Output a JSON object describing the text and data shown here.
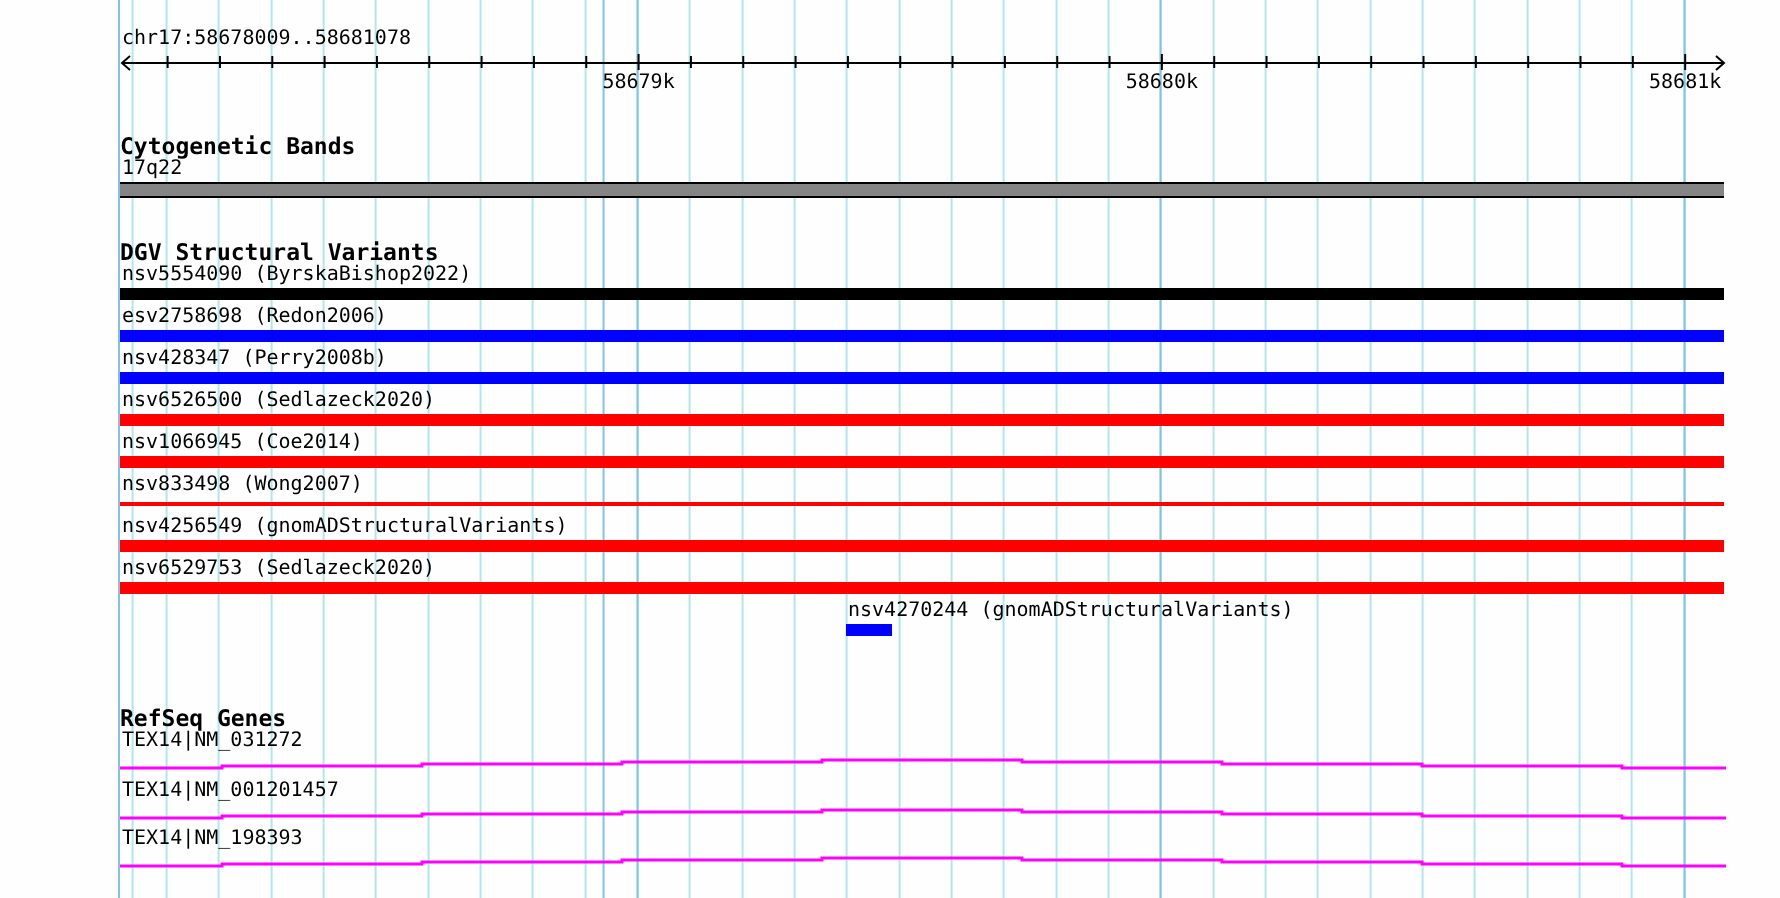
{
  "ruler": {
    "region": "chr17:58678009..58681078",
    "ticks": [
      "58679k",
      "58680k",
      "58681k"
    ]
  },
  "tracks": [
    {
      "kind": "bands",
      "title": "Cytogenetic Bands",
      "features": [
        {
          "label": "17q22"
        }
      ]
    },
    {
      "kind": "variants",
      "title": "DGV Structural Variants",
      "features": [
        {
          "label": "nsv5554090 (ByrskaBishop2022)",
          "color": "#000000",
          "kind": "full"
        },
        {
          "label": "esv2758698 (Redon2006)",
          "color": "#0000ff",
          "kind": "full"
        },
        {
          "label": "nsv428347 (Perry2008b)",
          "color": "#0000ff",
          "kind": "full"
        },
        {
          "label": "nsv6526500 (Sedlazeck2020)",
          "color": "#ff0000",
          "kind": "full"
        },
        {
          "label": "nsv1066945 (Coe2014)",
          "color": "#ff0000",
          "kind": "full"
        },
        {
          "label": "nsv833498 (Wong2007)",
          "color": "#ff0000",
          "kind": "thin"
        },
        {
          "label": "nsv4256549 (gnomADStructuralVariants)",
          "color": "#ff0000",
          "kind": "full"
        },
        {
          "label": "nsv6529753 (Sedlazeck2020)",
          "color": "#ff0000",
          "kind": "full"
        },
        {
          "label": "nsv4270244 (gnomADStructuralVariants)",
          "color": "#0000ff",
          "kind": "short"
        }
      ]
    },
    {
      "kind": "genes",
      "title": "RefSeq Genes",
      "features": [
        {
          "label": "TEX14|NM_031272"
        },
        {
          "label": "TEX14|NM_001201457"
        },
        {
          "label": "TEX14|NM_198393"
        }
      ]
    }
  ]
}
